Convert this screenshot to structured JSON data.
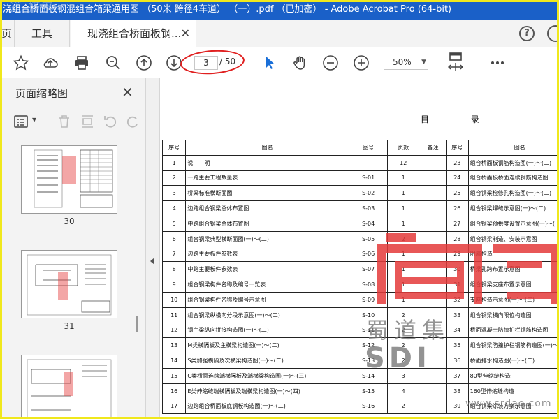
{
  "window": {
    "title": "浇组合桥面板钢混组合箱梁通用图 （50米 跨径4车道） （一）.pdf （已加密） - Adobe Acrobat Pro (64-bit)"
  },
  "watermark_top": "道 搭网",
  "tabs": {
    "home_label": "页",
    "tools_label": "工具",
    "doc_label": "现浇组合桥面板钢...",
    "close_glyph": "✕"
  },
  "toolbar": {
    "current_page": "3",
    "total_pages": "/ 50",
    "zoom": "50%",
    "zoom_arrow": "▼"
  },
  "help_glyph": "?",
  "sidebar": {
    "title": "页面缩略图",
    "close_glyph": "✕",
    "dropdown_arrow": "▾",
    "thumbnails": [
      {
        "label": "30"
      },
      {
        "label": "31"
      },
      {
        "label": ""
      }
    ]
  },
  "document": {
    "title": "目 录",
    "headers": {
      "no": "序号",
      "name": "图名",
      "code": "图号",
      "pages": "页数",
      "note": "备注"
    },
    "rows_left": [
      {
        "no": "1",
        "name": "说　　明",
        "code": "",
        "pages": "12"
      },
      {
        "no": "2",
        "name": "一跨主要工程数量表",
        "code": "S-01",
        "pages": "1"
      },
      {
        "no": "3",
        "name": "桥梁标准横断面图",
        "code": "S-02",
        "pages": "1"
      },
      {
        "no": "4",
        "name": "边跨组合钢梁总体布置图",
        "code": "S-03",
        "pages": "1"
      },
      {
        "no": "5",
        "name": "中跨组合钢梁总体布置图",
        "code": "S-04",
        "pages": "1"
      },
      {
        "no": "6",
        "name": "组合钢梁典型横断面图(一)～(二)",
        "code": "S-05",
        "pages": "2"
      },
      {
        "no": "7",
        "name": "边跨主要板件参数表",
        "code": "S-06",
        "pages": "1"
      },
      {
        "no": "8",
        "name": "中跨主要板件参数表",
        "code": "S-07",
        "pages": "1"
      },
      {
        "no": "9",
        "name": "组合钢梁构件名称及编号一览表",
        "code": "S-08",
        "pages": "1"
      },
      {
        "no": "10",
        "name": "组合钢梁构件名称及编号示意图",
        "code": "S-09",
        "pages": "1"
      },
      {
        "no": "11",
        "name": "组合钢梁纵横向分段示意图(一)～(二)",
        "code": "S-10",
        "pages": "2"
      },
      {
        "no": "12",
        "name": "钢主梁纵向拼接构造图(一)～(二)",
        "code": "S-11",
        "pages": "2"
      },
      {
        "no": "13",
        "name": "M类横隔板及主横梁构造图(一)～(二)",
        "code": "S-12",
        "pages": "2"
      },
      {
        "no": "14",
        "name": "S类加强横隔及次横梁构造图(一)～(二)",
        "code": "S-13",
        "pages": "2"
      },
      {
        "no": "15",
        "name": "C类桥面连续端横隔板及端横梁构造图(一)～(三)",
        "code": "S-14",
        "pages": "3"
      },
      {
        "no": "16",
        "name": "E类伸缩缝端横隔板及端横梁构造图(一)～(四)",
        "code": "S-15",
        "pages": "4"
      },
      {
        "no": "17",
        "name": "边跨组合桥面板底钢板构造图(一)～(二)",
        "code": "S-16",
        "pages": "2"
      }
    ],
    "rows_right": [
      {
        "no": "23",
        "name": "组合桥面板钢筋构造图(一)～(二)"
      },
      {
        "no": "24",
        "name": "组合桥面板桥面连续钢筋构造图"
      },
      {
        "no": "25",
        "name": "组合钢梁检修孔构造图(一)～(二)"
      },
      {
        "no": "26",
        "name": "组合钢梁焊缝示意图(一)～(二)"
      },
      {
        "no": "27",
        "name": "组合钢梁预拱度设置示意图(一)～("
      },
      {
        "no": "28",
        "name": "组合钢梁制造、安装示意图"
      },
      {
        "no": "29",
        "name": "附属构造"
      },
      {
        "no": "30",
        "name": "桥梁孔跨布置示意图"
      },
      {
        "no": "31",
        "name": "组合钢梁支座布置示意图"
      },
      {
        "no": "32",
        "name": "支座构造示意图(一)～(三)"
      },
      {
        "no": "33",
        "name": "组合钢梁横向限位构造图"
      },
      {
        "no": "34",
        "name": "桥面混凝土防撞护栏钢筋构造图"
      },
      {
        "no": "35",
        "name": "组合钢梁防撞护栏钢筋构造图(一)～("
      },
      {
        "no": "36",
        "name": "桥面排水构造图(一)～(二)"
      },
      {
        "no": "37",
        "name": "80型伸缩缝构造"
      },
      {
        "no": "38",
        "name": "160型伸缩缝构造"
      },
      {
        "no": "39",
        "name": "组合钢梁涂装方案示意图"
      }
    ]
  },
  "logo": {
    "cn": "蜀道集",
    "en": "SDI",
    "url": "www.srdao.com"
  },
  "colors": {
    "titlebar": "#1a60c8",
    "frame": "#f0e81c",
    "annotation": "#e02020",
    "logo_red": "#e43a3a"
  }
}
